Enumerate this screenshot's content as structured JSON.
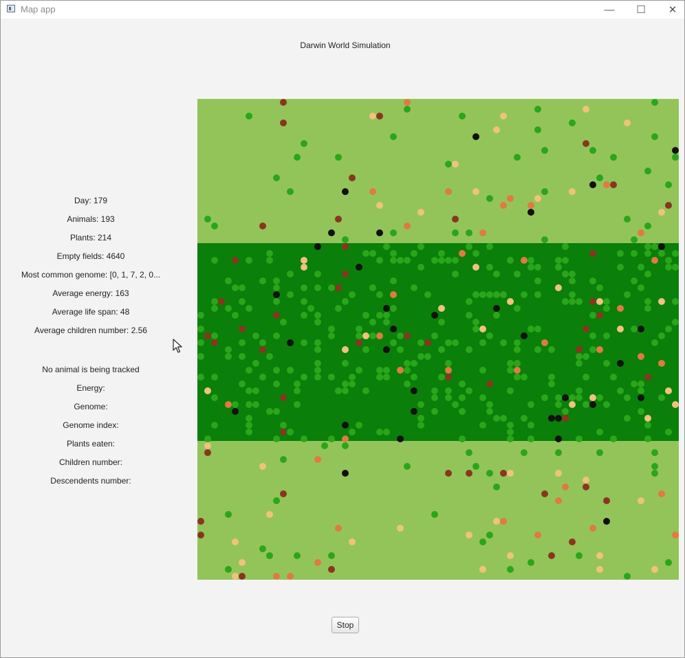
{
  "window": {
    "title": "Map app",
    "controls": {
      "minimize": "—",
      "maximize": "☐",
      "close": "✕"
    }
  },
  "header": {
    "title": "Darwin World Simulation"
  },
  "stats": {
    "day": "Day: 179",
    "animals": "Animals: 193",
    "plants": "Plants: 214",
    "empty_fields": "Empty fields: 4640",
    "most_common_genome": "Most common genome: [0, 1, 7, 2, 0...",
    "average_energy": "Average energy: 163",
    "average_life_span": "Average life span: 48",
    "average_children": "Average children number: 2.56"
  },
  "tracking": {
    "status": "No animal is being tracked",
    "energy": "Energy:",
    "genome": "Genome:",
    "genome_index": "Genome index:",
    "plants_eaten": "Plants eaten:",
    "children_number": "Children number:",
    "descendants_number": "Descendents number:"
  },
  "controls": {
    "stop_label": "Stop"
  },
  "map": {
    "grid": [
      70,
      70
    ],
    "colors": {
      "steppe": "#93c45a",
      "jungle": "#0a7f0a",
      "plant": "#2aa61a",
      "animal_low": "#f0c27d",
      "animal_mid": "#e07a42",
      "animal_high": "#8a3520",
      "animal_top": "#111111"
    }
  }
}
